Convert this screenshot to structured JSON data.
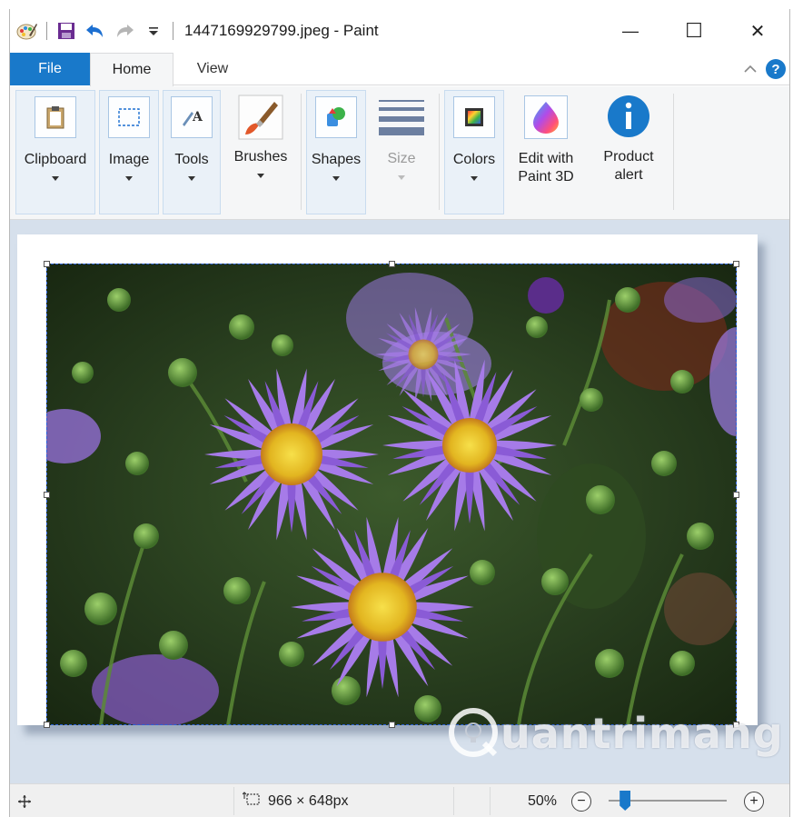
{
  "window": {
    "title": "1447169929799.jpeg - Paint",
    "minimize_glyph": "—",
    "maximize_glyph": "☐",
    "close_glyph": "✕"
  },
  "quick_access": {
    "icons": [
      "paint-app-icon",
      "save-icon",
      "undo-icon",
      "redo-icon",
      "customize-dropdown-icon"
    ]
  },
  "tabs": {
    "file": "File",
    "home": "Home",
    "view": "View"
  },
  "ribbon": {
    "clipboard": "Clipboard",
    "image": "Image",
    "tools": "Tools",
    "brushes": "Brushes",
    "shapes": "Shapes",
    "size": "Size",
    "colors": "Colors",
    "edit_paint3d_line1": "Edit with",
    "edit_paint3d_line2": "Paint 3D",
    "product_alert_line1": "Product",
    "product_alert_line2": "alert"
  },
  "watermark": {
    "text": "uantrimang"
  },
  "status": {
    "image_size": "966 × 648px",
    "zoom": "50%",
    "zoom_level_percent": 50
  },
  "colors": {
    "accent": "#1979ca",
    "canvas_bg": "#d6e0ec",
    "selection": "#2b5fd9"
  }
}
